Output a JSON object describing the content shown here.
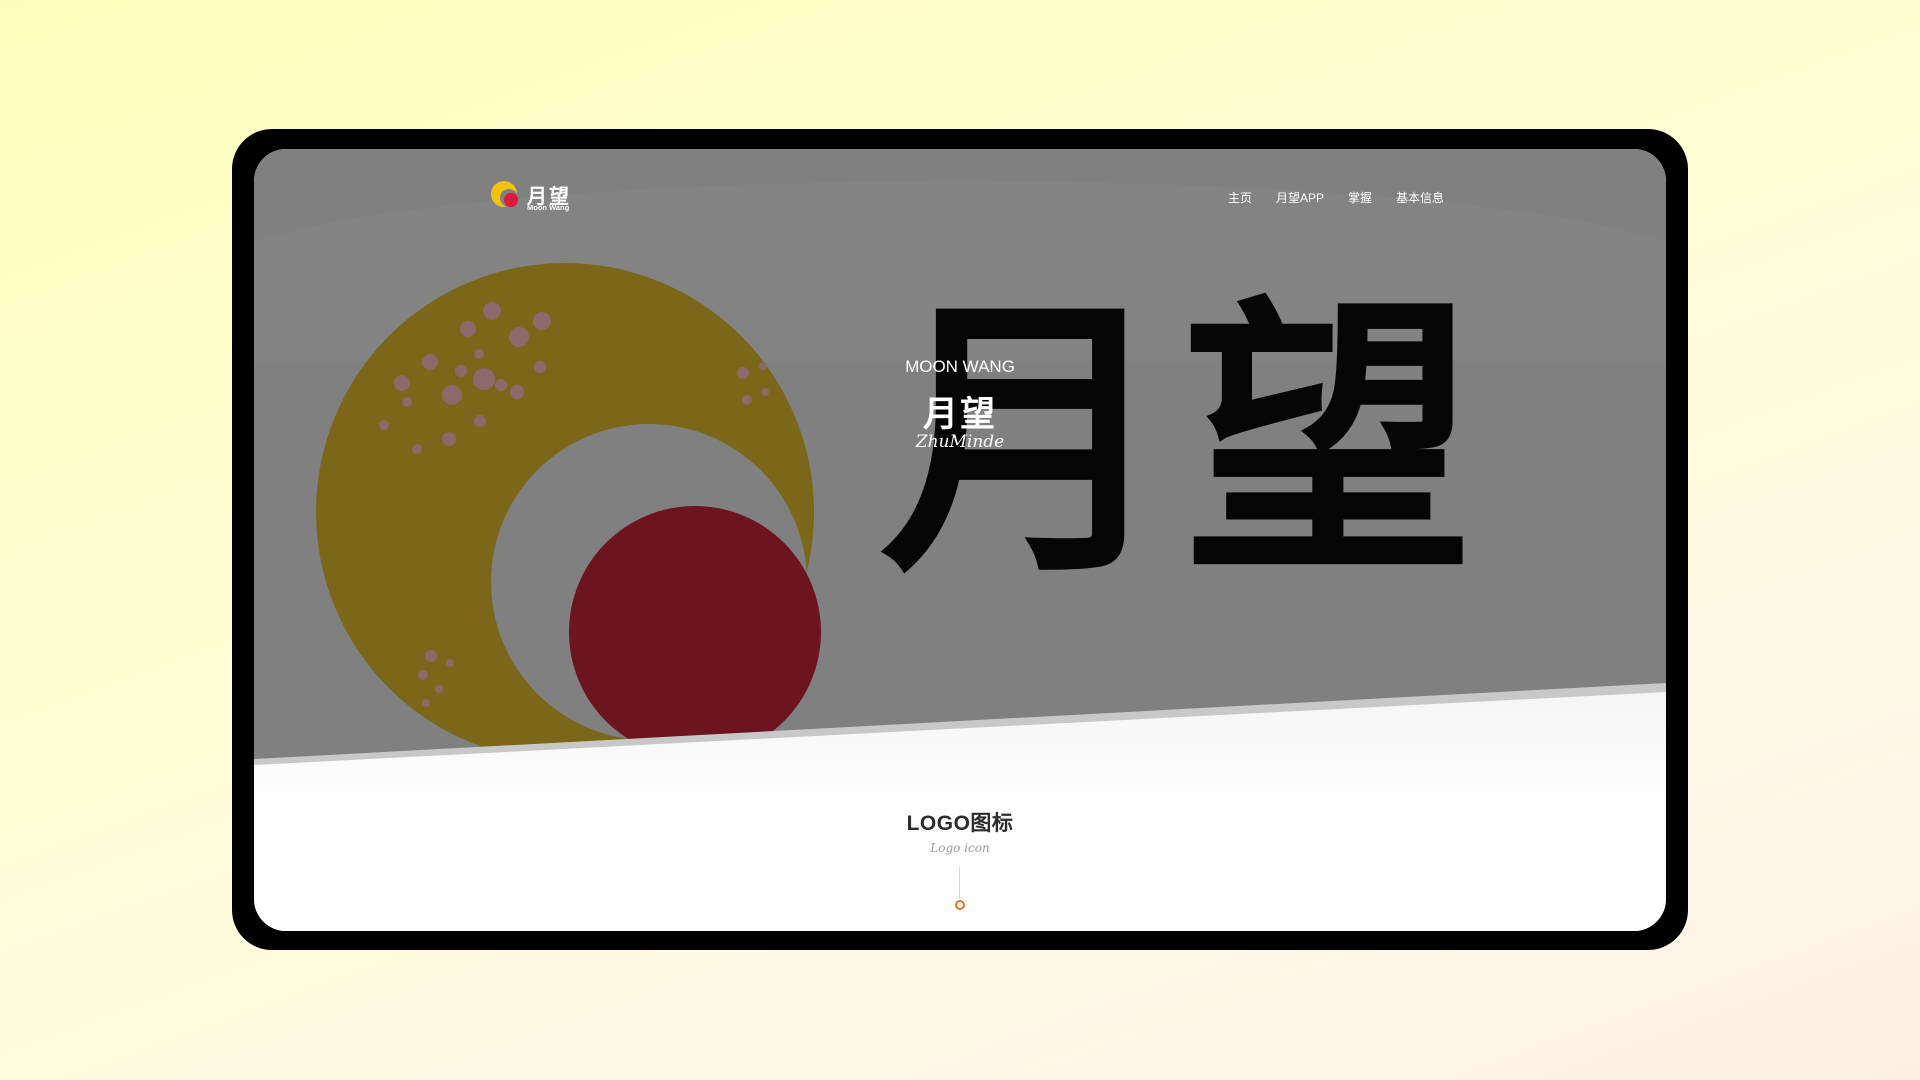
{
  "nav": {
    "logo_cn": "月望",
    "logo_en": "Moon Wang",
    "items": [
      "主页",
      "月望APP",
      "掌握",
      "基本信息"
    ]
  },
  "hero": {
    "title_en": "MOON WANG",
    "title_cn": "月望",
    "script_text": "ZhuMinde",
    "big_glyphs": "月望"
  },
  "section": {
    "title": "LOGO图标",
    "subtitle": "Logo icon"
  },
  "colors": {
    "page_bg": "#fdfdbb",
    "hero_bg": "#808080",
    "crescent": "#7a6719",
    "sun": "#6c1520",
    "blossom": "#8a6a6a",
    "accent_dot": "#e87722"
  },
  "icons": [
    "moon-logo-icon",
    "crescent-moon-graphic",
    "red-sun-graphic",
    "blossom-cluster-graphic"
  ]
}
